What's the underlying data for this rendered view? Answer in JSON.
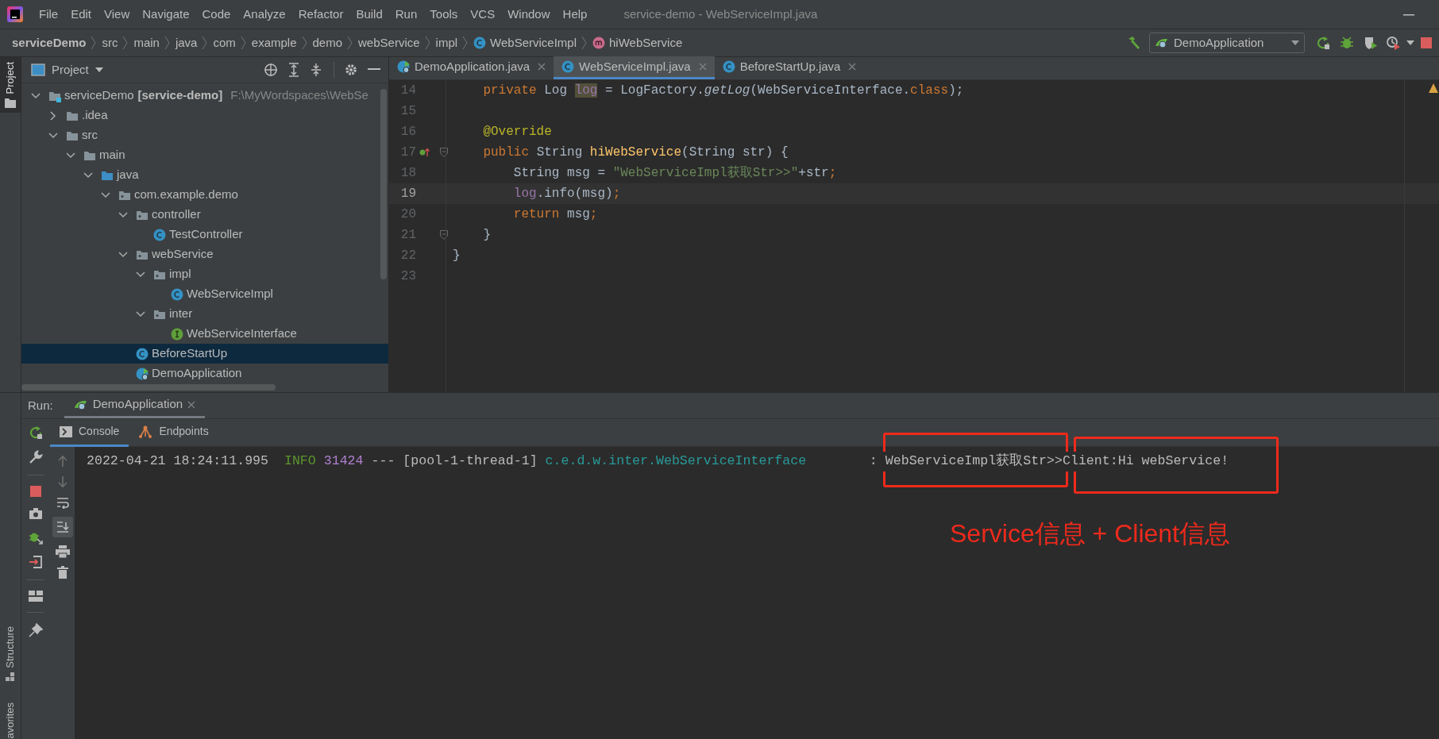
{
  "window": {
    "title": "service-demo - WebServiceImpl.java"
  },
  "menu": [
    "File",
    "Edit",
    "View",
    "Navigate",
    "Code",
    "Analyze",
    "Refactor",
    "Build",
    "Run",
    "Tools",
    "VCS",
    "Window",
    "Help"
  ],
  "breadcrumbs": [
    {
      "label": "serviceDemo",
      "kind": "project"
    },
    {
      "label": "src",
      "kind": "folder"
    },
    {
      "label": "main",
      "kind": "folder"
    },
    {
      "label": "java",
      "kind": "folder"
    },
    {
      "label": "com",
      "kind": "folder"
    },
    {
      "label": "example",
      "kind": "folder"
    },
    {
      "label": "demo",
      "kind": "folder"
    },
    {
      "label": "webService",
      "kind": "folder"
    },
    {
      "label": "impl",
      "kind": "folder"
    },
    {
      "label": "WebServiceImpl",
      "kind": "class"
    },
    {
      "label": "hiWebService",
      "kind": "method"
    }
  ],
  "run_config": "DemoApplication",
  "side_tabs": {
    "top": [
      {
        "label": "Project",
        "selected": true
      }
    ],
    "bottom": [
      {
        "label": "Structure",
        "selected": false
      },
      {
        "label": "avorites",
        "selected": false
      }
    ]
  },
  "project_panel": {
    "title": "Project",
    "tree": [
      {
        "label": "serviceDemo",
        "module": "[service-demo]",
        "path": "F:\\MyWordspaces\\WebSe",
        "kind": "module",
        "expanded": true,
        "selected": false,
        "children": [
          {
            "label": ".idea",
            "kind": "folder",
            "expanded": false,
            "selected": false
          },
          {
            "label": "src",
            "kind": "folder",
            "expanded": true,
            "selected": false,
            "children": [
              {
                "label": "main",
                "kind": "folder",
                "expanded": true,
                "selected": false,
                "children": [
                  {
                    "label": "java",
                    "kind": "source",
                    "expanded": true,
                    "selected": false,
                    "children": [
                      {
                        "label": "com.example.demo",
                        "kind": "package",
                        "expanded": true,
                        "selected": false,
                        "children": [
                          {
                            "label": "controller",
                            "kind": "package",
                            "expanded": true,
                            "selected": false,
                            "children": [
                              {
                                "label": "TestController",
                                "kind": "class",
                                "selected": false
                              }
                            ]
                          },
                          {
                            "label": "webService",
                            "kind": "package",
                            "expanded": true,
                            "selected": false,
                            "children": [
                              {
                                "label": "impl",
                                "kind": "package",
                                "expanded": true,
                                "selected": false,
                                "children": [
                                  {
                                    "label": "WebServiceImpl",
                                    "kind": "class",
                                    "selected": false
                                  }
                                ]
                              },
                              {
                                "label": "inter",
                                "kind": "package",
                                "expanded": true,
                                "selected": false,
                                "children": [
                                  {
                                    "label": "WebServiceInterface",
                                    "kind": "interface",
                                    "selected": false
                                  }
                                ]
                              }
                            ]
                          },
                          {
                            "label": "BeforeStartUp",
                            "kind": "class",
                            "selected": true
                          },
                          {
                            "label": "DemoApplication",
                            "kind": "spring",
                            "selected": false
                          }
                        ]
                      }
                    ]
                  }
                ]
              }
            ]
          }
        ]
      }
    ]
  },
  "editor_tabs": [
    {
      "label": "DemoApplication.java",
      "kind": "spring",
      "selected": false
    },
    {
      "label": "WebServiceImpl.java",
      "kind": "class",
      "selected": true
    },
    {
      "label": "BeforeStartUp.java",
      "kind": "class",
      "selected": false
    }
  ],
  "code": [
    {
      "number": "14",
      "current": false,
      "tokens": [
        {
          "text": "    private ",
          "kind": "keyword"
        },
        {
          "text": "Log ",
          "kind": "plain"
        },
        {
          "text": "log",
          "kind": "usage"
        },
        {
          "text": " = LogFactory.",
          "kind": "plain"
        },
        {
          "text": "getLog",
          "kind": "static"
        },
        {
          "text": "(WebServiceInterface.",
          "kind": "plain"
        },
        {
          "text": "class",
          "kind": "keyword"
        },
        {
          "text": ");",
          "kind": "plain"
        }
      ]
    },
    {
      "number": "15",
      "current": false
    },
    {
      "number": "16",
      "current": false,
      "tokens": [
        {
          "text": "    @Override",
          "kind": "annotation"
        }
      ]
    },
    {
      "number": "17",
      "current": false,
      "implements": true,
      "fold": true,
      "tokens": [
        {
          "text": "    public ",
          "kind": "keyword"
        },
        {
          "text": "String ",
          "kind": "plain"
        },
        {
          "text": "hiWebService",
          "kind": "declaration"
        },
        {
          "text": "(String str) {",
          "kind": "plain"
        }
      ]
    },
    {
      "number": "18",
      "current": false,
      "tokens": [
        {
          "text": "        String msg = ",
          "kind": "plain"
        },
        {
          "text": "\"WebServiceImpl获取Str>>\"",
          "kind": "string"
        },
        {
          "text": "+str",
          "kind": "plain"
        },
        {
          "text": ";",
          "kind": "keyword"
        }
      ]
    },
    {
      "number": "19",
      "current": true,
      "tokens": [
        {
          "text": "        log",
          "kind": "field"
        },
        {
          "text": ".info(msg)",
          "kind": "plain"
        },
        {
          "text": ";",
          "kind": "keyword"
        }
      ]
    },
    {
      "number": "20",
      "current": false,
      "tokens": [
        {
          "text": "        return ",
          "kind": "keyword"
        },
        {
          "text": "msg",
          "kind": "plain"
        },
        {
          "text": ";",
          "kind": "keyword"
        }
      ]
    },
    {
      "number": "21",
      "current": false,
      "fold": true,
      "tokens": [
        {
          "text": "    }",
          "kind": "plain"
        }
      ]
    },
    {
      "number": "22",
      "current": false,
      "tokens": [
        {
          "text": "}",
          "kind": "plain"
        }
      ]
    },
    {
      "number": "23",
      "current": false
    }
  ],
  "run_panel": {
    "label": "Run:",
    "tab": "DemoApplication",
    "tabs": [
      {
        "label": "Console",
        "kind": "console",
        "selected": true
      },
      {
        "label": "Endpoints",
        "kind": "endpoints",
        "selected": false
      }
    ],
    "console": [
      [
        {
          "text": "2022-04-21 18:24:11.995  ",
          "kind": "text"
        },
        {
          "text": "INFO ",
          "kind": "level"
        },
        {
          "text": "31424",
          "kind": "pid"
        },
        {
          "text": " --- [pool-1-thread-1] ",
          "kind": "text"
        },
        {
          "text": "c.e.d.w.inter.WebServiceInterface",
          "kind": "logger"
        },
        {
          "text": "        : WebServiceImpl获取Str>>Client:Hi webService!",
          "kind": "text"
        }
      ]
    ]
  },
  "annotation": {
    "text": "Service信息 + Client信息"
  }
}
